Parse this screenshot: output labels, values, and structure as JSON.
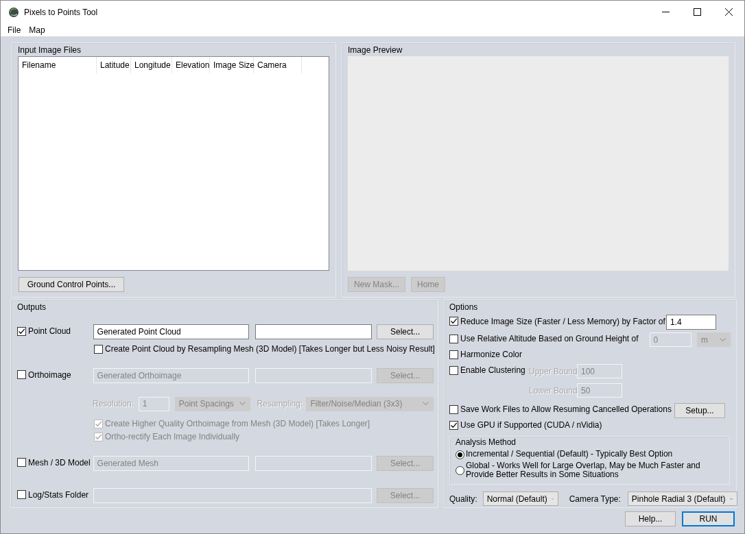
{
  "window": {
    "title": "Pixels to Points Tool",
    "menu": [
      "File",
      "Map"
    ]
  },
  "input_files": {
    "title": "Input Image Files",
    "columns": [
      "Filename",
      "Latitude",
      "Longitude",
      "Elevation",
      "Image Size",
      "Camera"
    ],
    "button": "Ground Control Points..."
  },
  "image_preview": {
    "title": "Image Preview",
    "buttons": [
      {
        "label": "New Mask...",
        "disabled": true
      },
      {
        "label": "Home",
        "disabled": true
      }
    ]
  },
  "outputs": {
    "title": "Outputs",
    "rows": [
      {
        "kind": "output",
        "label": "Point Cloud",
        "checked": true,
        "value": "Generated Point Cloud",
        "fields_disabled": false,
        "button": "Select..."
      },
      {
        "kind": "suboption",
        "label": "Create Point Cloud by Resampling Mesh (3D Model) [Takes Longer but Less Noisy Result]",
        "checked": false,
        "disabled": false
      },
      {
        "kind": "output",
        "label": "Orthoimage",
        "checked": false,
        "value": "Generated Orthoimage",
        "fields_disabled": true,
        "button": "Select..."
      },
      {
        "kind": "settings",
        "disabled": true,
        "resolution_label": "Resolution:",
        "resolution": "1",
        "unit": "Point Spacings",
        "resampling_label": "Resampling:",
        "resampling": "Filter/Noise/Median (3x3)"
      },
      {
        "kind": "suboption",
        "label": "Create Higher Quality Orthoimage from Mesh (3D Model) [Takes Longer]",
        "checked": true,
        "disabled": true
      },
      {
        "kind": "suboption",
        "label": "Ortho-rectify Each Image Individually",
        "checked": true,
        "disabled": true
      },
      {
        "kind": "output",
        "label": "Mesh / 3D Model",
        "checked": false,
        "value": "Generated Mesh",
        "fields_disabled": true,
        "button": "Select..."
      },
      {
        "kind": "folder",
        "label": "Log/Stats Folder",
        "checked": false,
        "fields_disabled": true,
        "button": "Select..."
      }
    ]
  },
  "options": {
    "title": "Options",
    "rows": [
      {
        "kind": "factor",
        "label": "Reduce Image Size (Faster / Less Memory) by Factor of",
        "checked": true,
        "value": "1.4"
      },
      {
        "kind": "altitude",
        "label": "Use Relative Altitude Based on Ground Height of",
        "checked": false,
        "value": "0",
        "unit": "m"
      },
      {
        "kind": "check",
        "label": "Harmonize Color",
        "checked": false
      },
      {
        "kind": "clustering",
        "label": "Enable Clustering",
        "checked": false,
        "upper_label": "Upper Bound",
        "upper": "100",
        "lower_label": "Lower Bound",
        "lower": "50"
      },
      {
        "kind": "setup",
        "label": "Save Work Files to Allow Resuming Cancelled Operations",
        "checked": false,
        "button": "Setup..."
      },
      {
        "kind": "check",
        "label": "Use GPU if Supported (CUDA / nVidia)",
        "checked": true
      }
    ],
    "analysis_method": {
      "title": "Analysis Method",
      "options": [
        {
          "label": "Incremental / Sequential (Default) - Typically Best Option",
          "selected": true
        },
        {
          "label": "Global - Works Well for Large Overlap, May be Much Faster and Provide Better Results in Some Situations",
          "selected": false
        }
      ]
    },
    "quality_label": "Quality:",
    "quality": "Normal (Default)",
    "camera_label": "Camera Type:",
    "camera": "Pinhole Radial 3 (Default)"
  },
  "buttons": [
    {
      "label": "Help...",
      "default": false
    },
    {
      "label": "RUN",
      "default": true
    }
  ]
}
